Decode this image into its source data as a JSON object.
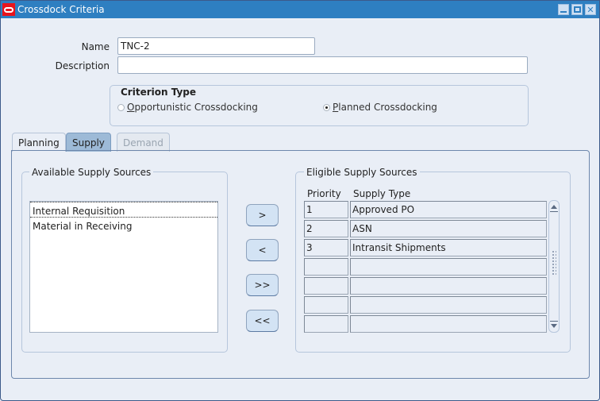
{
  "window": {
    "title": "Crossdock Criteria",
    "controls": [
      "minimize",
      "maximize",
      "close"
    ]
  },
  "form": {
    "name_label": "Name",
    "name_value": "TNC-2",
    "description_label": "Description",
    "description_value": ""
  },
  "criterion_type": {
    "title": "Criterion Type",
    "options": [
      {
        "label": "Opportunistic Crossdocking",
        "mnemonic": "O",
        "rest": "pportunistic Crossdocking",
        "selected": false
      },
      {
        "label": "Planned Crossdocking",
        "mnemonic": "P",
        "rest": "lanned Crossdocking",
        "selected": true
      }
    ]
  },
  "tabs": [
    {
      "label": "Planning",
      "state": "normal"
    },
    {
      "label": "Supply",
      "state": "active"
    },
    {
      "label": "Demand",
      "state": "disabled"
    }
  ],
  "available": {
    "title": "Available Supply Sources",
    "items": [
      "Internal Requisition",
      "Material in Receiving"
    ]
  },
  "shuttle": {
    "move_one": ">",
    "remove_one": "<",
    "move_all": ">>",
    "remove_all": "<<"
  },
  "eligible": {
    "title": "Eligible Supply Sources",
    "columns": [
      "Priority",
      "Supply Type"
    ],
    "rows": [
      {
        "priority": "1",
        "supply_type": "Approved PO"
      },
      {
        "priority": "2",
        "supply_type": "ASN"
      },
      {
        "priority": "3",
        "supply_type": "Intransit Shipments"
      },
      {
        "priority": "",
        "supply_type": ""
      },
      {
        "priority": "",
        "supply_type": ""
      },
      {
        "priority": "",
        "supply_type": ""
      },
      {
        "priority": "",
        "supply_type": ""
      }
    ]
  },
  "colors": {
    "titlebar": "#2e7fc1",
    "background": "#e9eef6",
    "active_tab": "#9dbad7",
    "button": "#d3e3f4",
    "logo": "#e8141c"
  }
}
